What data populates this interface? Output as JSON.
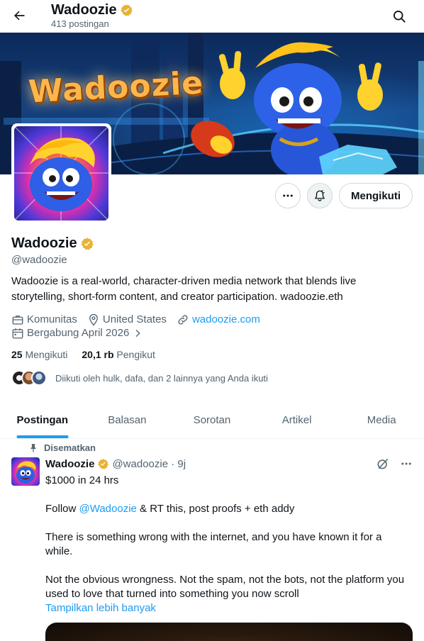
{
  "header": {
    "name": "Wadoozie",
    "post_count": "413 postingan"
  },
  "banner": {
    "logo_text": "Wadoozie"
  },
  "actions": {
    "follow_label": "Mengikuti"
  },
  "profile": {
    "name": "Wadoozie",
    "handle": "@wadoozie",
    "bio": "Wadoozie is a real-world, character-driven media network that blends live storytelling, short-form content, and creator participation. wadoozie.eth",
    "category": "Komunitas",
    "location": "United States",
    "website": "wadoozie.com",
    "joined": "Bergabung April 2026",
    "following_count": "25",
    "following_label": "Mengikuti",
    "followers_count": "20,1 rb",
    "followers_label": "Pengikut",
    "followed_by": "Diikuti oleh hulk, dafa, dan 2 lainnya yang Anda ikuti"
  },
  "tabs": [
    {
      "label": "Postingan"
    },
    {
      "label": "Balasan"
    },
    {
      "label": "Sorotan"
    },
    {
      "label": "Artikel"
    },
    {
      "label": "Media"
    }
  ],
  "pinned_post": {
    "pinned_label": "Disematkan",
    "author": "Wadoozie",
    "handle_time": "@wadoozie · 9j",
    "line1": "$1000 in 24 hrs",
    "line2_prefix": "Follow ",
    "line2_mention": "@Wadoozie",
    "line2_suffix": " & RT this, post proofs + eth addy",
    "line3": "There is something wrong with the internet, and you have known it for a while.",
    "line4": "Not the obvious wrongness. Not the spam, not the bots, not the platform you used to love that turned into something you now scroll",
    "show_more": "Tampilkan lebih banyak"
  },
  "colors": {
    "accent": "#1d9bf0",
    "verified": "#e8b330",
    "text": "#0f1419",
    "muted": "#536471"
  },
  "icons": [
    "back-arrow-icon",
    "verified-badge-icon",
    "search-icon",
    "more-icon",
    "notification-bell-icon",
    "briefcase-icon",
    "location-icon",
    "link-icon",
    "calendar-icon",
    "chevron-right-icon",
    "pin-icon",
    "grok-slash-icon"
  ]
}
